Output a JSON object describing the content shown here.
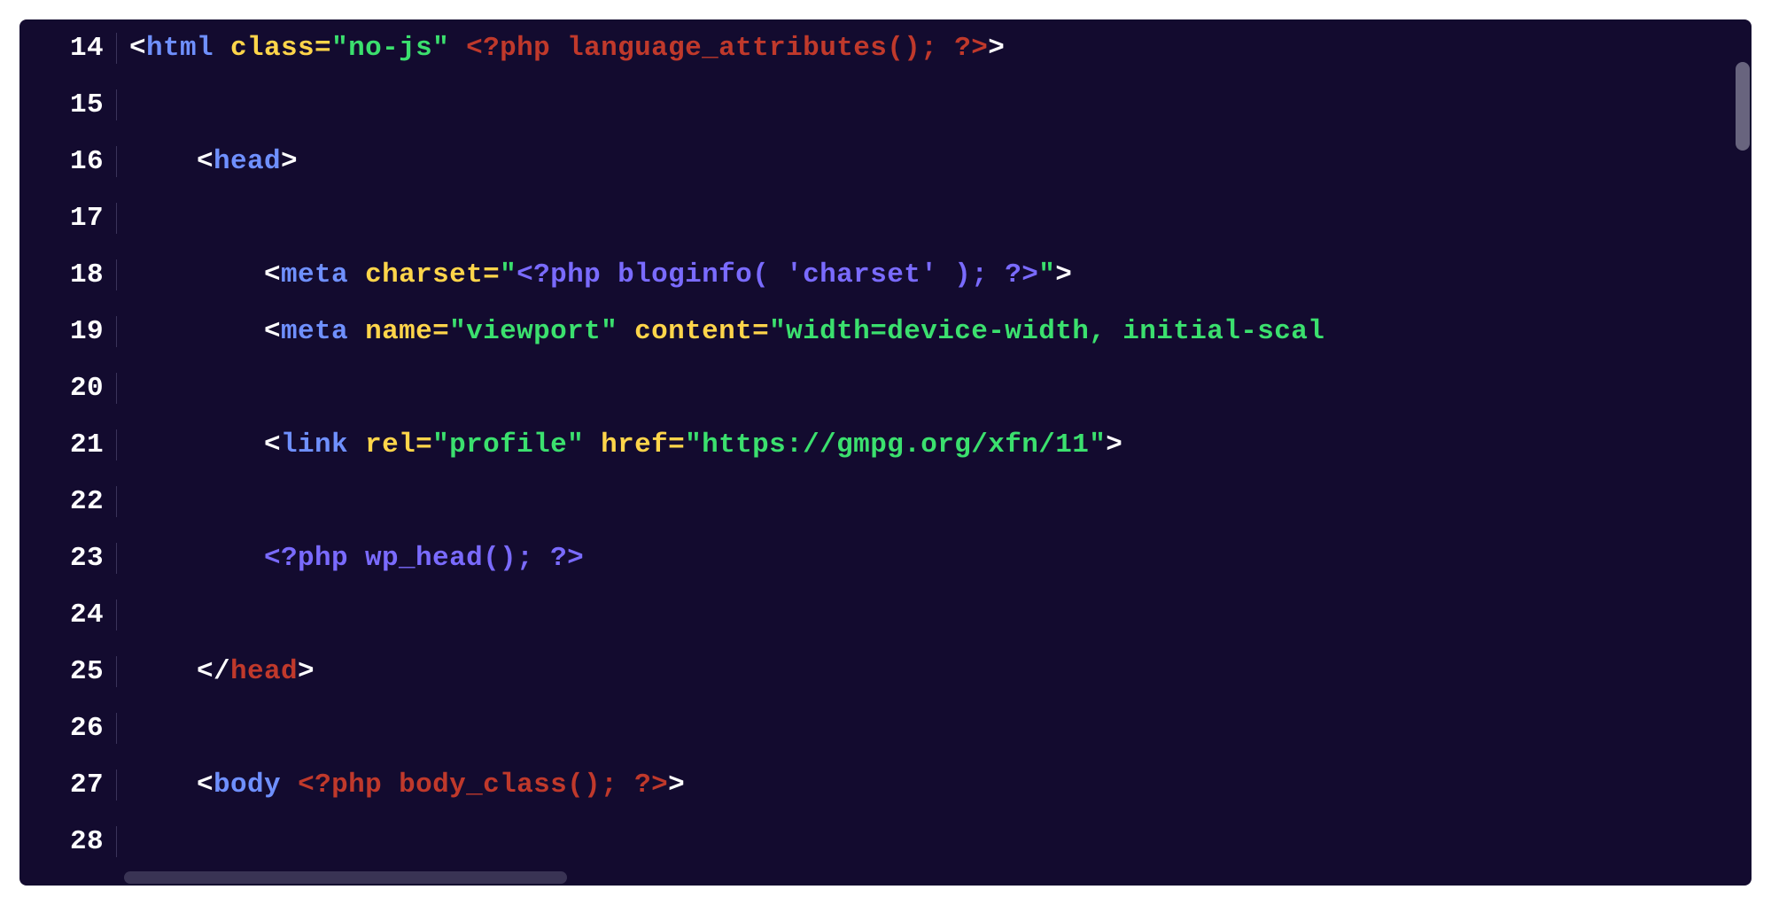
{
  "editor": {
    "first_line_number": 14,
    "colors": {
      "background": "#130b2f",
      "gutter_text": "#ffffff",
      "gutter_border": "#3a335a",
      "tag": "#6f90ff",
      "attr": "#ffd54a",
      "string": "#3be06e",
      "php": "#c0392b",
      "php_inline": "#7a6bff",
      "close_tag": "#c0392b",
      "punct": "#ffffff"
    },
    "lines": [
      {
        "n": 14,
        "indent": 0,
        "tokens": [
          {
            "t": "punct",
            "v": "<"
          },
          {
            "t": "tag",
            "v": "html"
          },
          {
            "t": "plain",
            "v": " "
          },
          {
            "t": "attr",
            "v": "class="
          },
          {
            "t": "str",
            "v": "\"no-js\""
          },
          {
            "t": "plain",
            "v": " "
          },
          {
            "t": "php",
            "v": "<?php language_attributes(); ?>"
          },
          {
            "t": "punct",
            "v": ">"
          }
        ]
      },
      {
        "n": 15,
        "indent": 0,
        "tokens": []
      },
      {
        "n": 16,
        "indent": 1,
        "tokens": [
          {
            "t": "punct",
            "v": "<"
          },
          {
            "t": "tag",
            "v": "head"
          },
          {
            "t": "punct",
            "v": ">"
          }
        ]
      },
      {
        "n": 17,
        "indent": 0,
        "tokens": []
      },
      {
        "n": 18,
        "indent": 2,
        "tokens": [
          {
            "t": "punct",
            "v": "<"
          },
          {
            "t": "tag",
            "v": "meta"
          },
          {
            "t": "plain",
            "v": " "
          },
          {
            "t": "attr",
            "v": "charset="
          },
          {
            "t": "str",
            "v": "\""
          },
          {
            "t": "phpattr",
            "v": "<?php bloginfo( 'charset' ); ?>"
          },
          {
            "t": "str",
            "v": "\""
          },
          {
            "t": "punct",
            "v": ">"
          }
        ]
      },
      {
        "n": 19,
        "indent": 2,
        "tokens": [
          {
            "t": "punct",
            "v": "<"
          },
          {
            "t": "tag",
            "v": "meta"
          },
          {
            "t": "plain",
            "v": " "
          },
          {
            "t": "attr",
            "v": "name="
          },
          {
            "t": "str",
            "v": "\"viewport\""
          },
          {
            "t": "plain",
            "v": " "
          },
          {
            "t": "attr",
            "v": "content="
          },
          {
            "t": "str",
            "v": "\"width=device-width, initial-scal"
          }
        ]
      },
      {
        "n": 20,
        "indent": 0,
        "tokens": []
      },
      {
        "n": 21,
        "indent": 2,
        "tokens": [
          {
            "t": "punct",
            "v": "<"
          },
          {
            "t": "tag",
            "v": "link"
          },
          {
            "t": "plain",
            "v": " "
          },
          {
            "t": "attr",
            "v": "rel="
          },
          {
            "t": "str",
            "v": "\"profile\""
          },
          {
            "t": "plain",
            "v": " "
          },
          {
            "t": "attr",
            "v": "href="
          },
          {
            "t": "str",
            "v": "\"https://gmpg.org/xfn/11\""
          },
          {
            "t": "punct",
            "v": ">"
          }
        ]
      },
      {
        "n": 22,
        "indent": 0,
        "tokens": []
      },
      {
        "n": 23,
        "indent": 2,
        "tokens": [
          {
            "t": "phpattr",
            "v": "<?php wp_head(); ?>"
          }
        ]
      },
      {
        "n": 24,
        "indent": 0,
        "tokens": []
      },
      {
        "n": 25,
        "indent": 1,
        "tokens": [
          {
            "t": "punct",
            "v": "</"
          },
          {
            "t": "closetag",
            "v": "head"
          },
          {
            "t": "punct",
            "v": ">"
          }
        ]
      },
      {
        "n": 26,
        "indent": 0,
        "tokens": []
      },
      {
        "n": 27,
        "indent": 1,
        "tokens": [
          {
            "t": "punct",
            "v": "<"
          },
          {
            "t": "tag",
            "v": "body"
          },
          {
            "t": "plain",
            "v": " "
          },
          {
            "t": "php",
            "v": "<?php body_class(); ?>"
          },
          {
            "t": "punct",
            "v": ">"
          }
        ]
      },
      {
        "n": 28,
        "indent": 0,
        "tokens": []
      }
    ],
    "indent_unit": "    "
  }
}
